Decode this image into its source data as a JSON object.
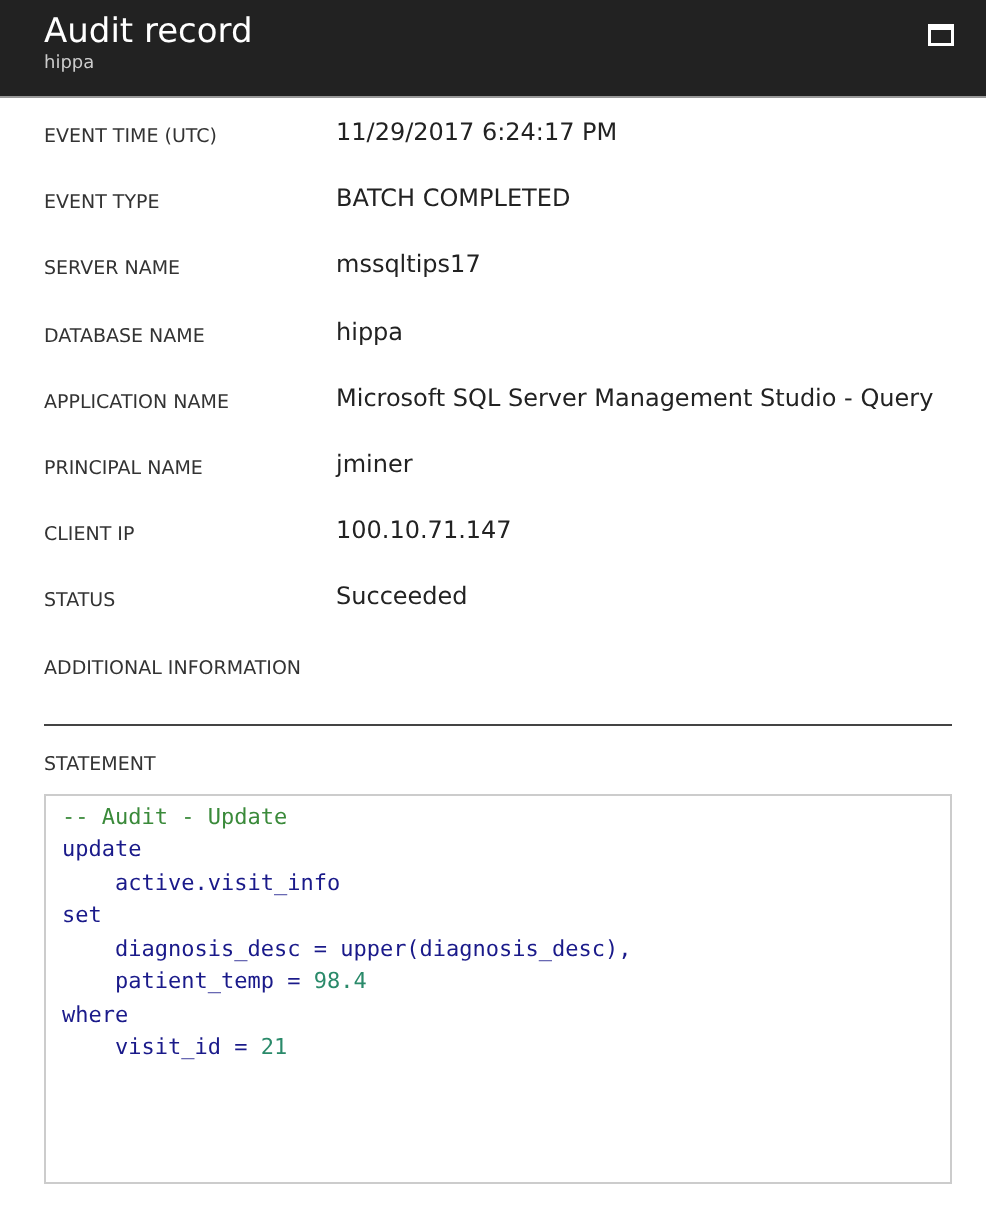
{
  "header": {
    "title": "Audit record",
    "subtitle": "hippa"
  },
  "fields": [
    {
      "label": "EVENT TIME (UTC)",
      "value": "11/29/2017 6:24:17 PM"
    },
    {
      "label": "EVENT TYPE",
      "value": "BATCH COMPLETED"
    },
    {
      "label": "SERVER NAME",
      "value": "mssqltips17"
    },
    {
      "label": "DATABASE NAME",
      "value": "hippa"
    },
    {
      "label": "APPLICATION NAME",
      "value": "Microsoft SQL Server Management Studio - Query"
    },
    {
      "label": "PRINCIPAL NAME",
      "value": "jminer"
    },
    {
      "label": "CLIENT IP",
      "value": "100.10.71.147"
    },
    {
      "label": "STATUS",
      "value": "Succeeded"
    },
    {
      "label": "ADDITIONAL INFORMATION"
    }
  ],
  "statement": {
    "label": "STATEMENT",
    "lines": [
      {
        "tokens": [
          {
            "kind": "comment",
            "text": "-- Audit - Update"
          }
        ]
      },
      {
        "tokens": [
          {
            "kind": "keyword",
            "text": "update"
          }
        ]
      },
      {
        "tokens": [
          {
            "kind": "plain",
            "text": "    active"
          },
          {
            "kind": "plain",
            "text": ".visit_info"
          }
        ]
      },
      {
        "tokens": [
          {
            "kind": "keyword",
            "text": "set"
          }
        ]
      },
      {
        "tokens": [
          {
            "kind": "plain",
            "text": "    diagnosis_desc = upper(diagnosis_desc),"
          }
        ]
      },
      {
        "tokens": [
          {
            "kind": "plain",
            "text": "    patient_temp = "
          },
          {
            "kind": "number",
            "text": "98.4"
          }
        ]
      },
      {
        "tokens": [
          {
            "kind": "keyword",
            "text": "where"
          }
        ]
      },
      {
        "tokens": [
          {
            "kind": "plain",
            "text": "    visit_id = "
          },
          {
            "kind": "number",
            "text": "21"
          }
        ]
      }
    ]
  }
}
